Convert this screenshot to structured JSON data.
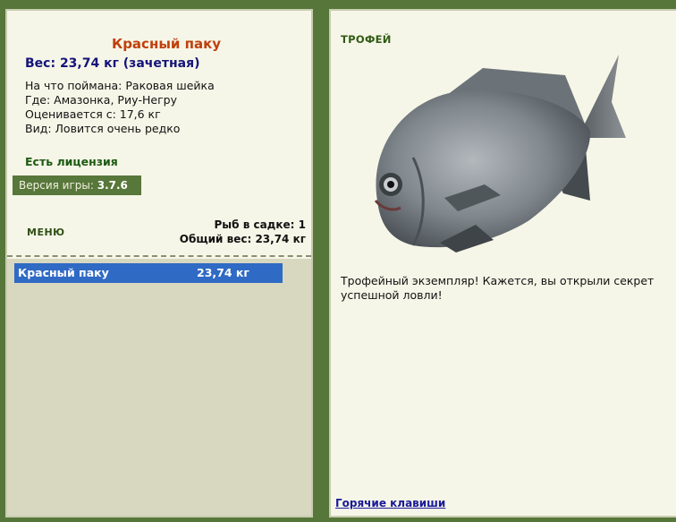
{
  "fish": {
    "title": "Красный паку",
    "weight": "Вес: 23,74 кг (зачетная)",
    "bait": "На что поймана: Раковая шейка",
    "location": "Где: Амазонка, Риу-Негру",
    "valued_from": "Оценивается с: 17,6 кг",
    "kind": "Вид: Ловится очень редко"
  },
  "license": "Есть лицензия",
  "version": {
    "label": "Версия игры:",
    "value": "3.7.6"
  },
  "menu_label": "МЕНЮ",
  "stats": {
    "count": "Рыб в садке: 1",
    "total": "Общий вес: 23,74 кг"
  },
  "catch_list": [
    {
      "name": "Красный паку",
      "weight": "23,74 кг"
    }
  ],
  "trophy": {
    "label": "ТРОФЕЙ",
    "description": "Трофейный экземпляр! Кажется, вы открыли секрет успешной ловли!"
  },
  "hotkeys_link": "Горячие клавиши",
  "colors": {
    "background": "#56763a",
    "panel": "#f6f6e8",
    "title": "#c0400a",
    "weight": "#14147a",
    "license": "#1c5a12",
    "selected_row": "#2f6ac4",
    "link": "#1a1a9a"
  }
}
